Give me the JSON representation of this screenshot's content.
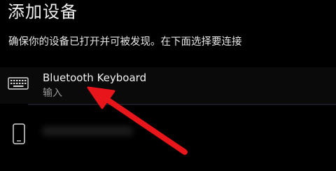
{
  "window": {
    "title": "添加设备",
    "subtitle": "确保你的设备已打开并可被发现。在下面选择要连接"
  },
  "devices": [
    {
      "name": "Bluetooth Keyboard",
      "type": "输入",
      "icon": "keyboard-icon"
    },
    {
      "name": "",
      "type": "",
      "icon": "phone-icon"
    }
  ],
  "annotation": {
    "arrow_color": "#e8161b"
  }
}
